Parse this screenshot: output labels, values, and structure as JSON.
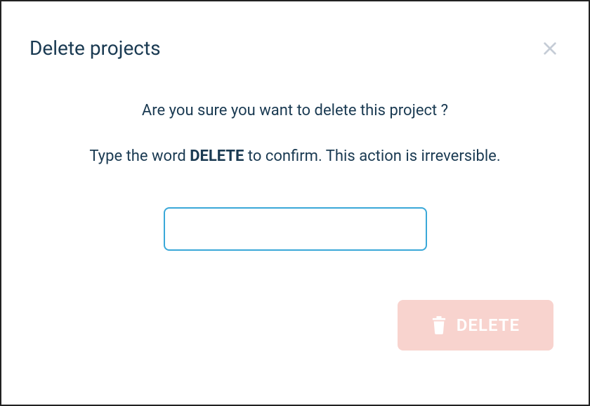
{
  "modal": {
    "title": "Delete projects",
    "question": "Are you sure you want to delete this project ?",
    "instruction_prefix": "Type the word ",
    "instruction_bold": "DELETE",
    "instruction_suffix": " to confirm. This action is irreversible.",
    "input_value": "",
    "delete_button_label": "DELETE"
  }
}
